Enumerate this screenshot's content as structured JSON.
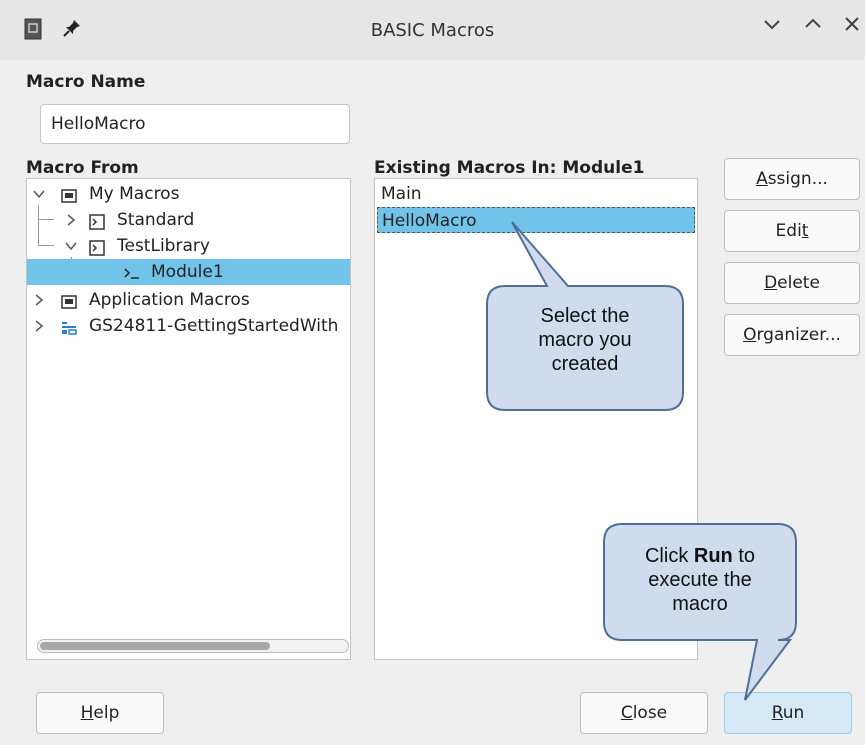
{
  "window": {
    "title": "BASIC Macros",
    "controls": [
      "minimize-chevron-down",
      "maximize-chevron-up",
      "close-x"
    ]
  },
  "macro_name": {
    "label": "Macro Name",
    "value": "HelloMacro"
  },
  "macro_from": {
    "label": "Macro From",
    "tree": [
      {
        "label": "My Macros",
        "level": 0,
        "expanded": true,
        "icon": "folder-icon"
      },
      {
        "label": "Standard",
        "level": 1,
        "expanded": false,
        "icon": "library-icon"
      },
      {
        "label": "TestLibrary",
        "level": 1,
        "expanded": true,
        "icon": "library-icon"
      },
      {
        "label": "Module1",
        "level": 2,
        "selected": true,
        "icon": "module-icon"
      },
      {
        "label": "Application Macros",
        "level": 0,
        "expanded": false,
        "icon": "folder-icon"
      },
      {
        "label": "GS24811-GettingStartedWith",
        "level": 0,
        "expanded": false,
        "icon": "document-icon"
      }
    ]
  },
  "existing": {
    "label": "Existing Macros In: Module1",
    "items": [
      {
        "label": "Main",
        "selected": false
      },
      {
        "label": "HelloMacro",
        "selected": true
      }
    ]
  },
  "buttons": {
    "assign": {
      "pre": "",
      "mn": "A",
      "post": "ssign..."
    },
    "edit": {
      "pre": "Edi",
      "mn": "t",
      "post": ""
    },
    "delete": {
      "pre": "",
      "mn": "D",
      "post": "elete"
    },
    "organizer": {
      "pre": "",
      "mn": "O",
      "post": "rganizer..."
    },
    "help": {
      "pre": "",
      "mn": "H",
      "post": "elp"
    },
    "close": {
      "pre": "",
      "mn": "C",
      "post": "lose"
    },
    "run": {
      "pre": "",
      "mn": "R",
      "post": "un"
    }
  },
  "callouts": {
    "select": {
      "lines": [
        "Select the",
        "macro you",
        "created"
      ]
    },
    "run": {
      "line1_pre": "Click ",
      "line1_bold": "Run",
      "line1_post": " to",
      "line2": "execute the",
      "line3": "macro"
    }
  },
  "colors": {
    "selection": "#72c3ea",
    "callout_fill": "#d0dced",
    "callout_stroke": "#4f6f98"
  }
}
